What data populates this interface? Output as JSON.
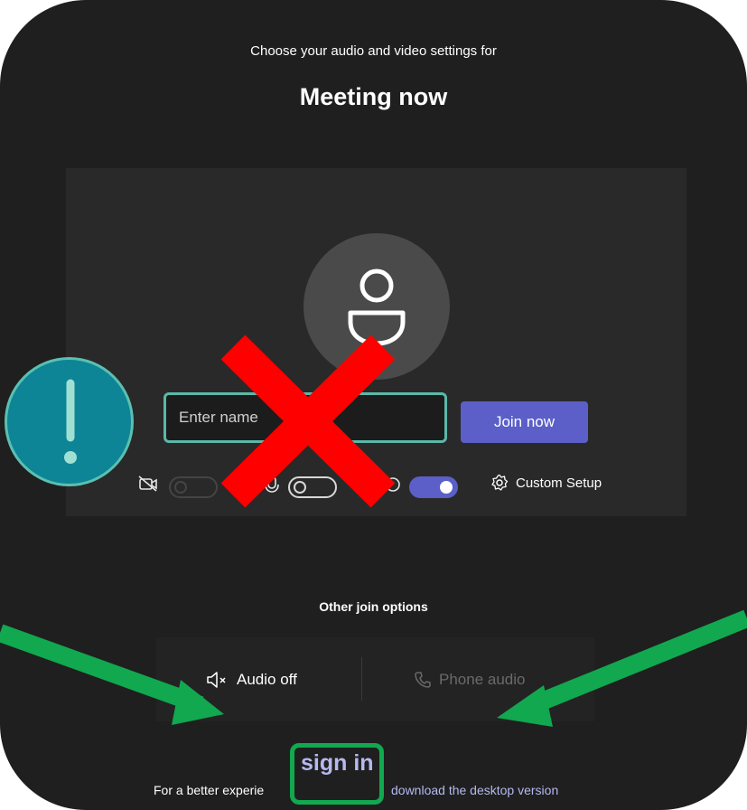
{
  "header": {
    "subtitle": "Choose your audio and video settings for",
    "meeting_title": "Meeting now"
  },
  "prejoin": {
    "name_placeholder": "Enter name",
    "join_label": "Join now",
    "custom_setup_label": "Custom Setup",
    "camera_toggle": "off",
    "mic_toggle": "off",
    "effects_toggle": "on"
  },
  "other_options": {
    "title": "Other join options",
    "audio_off_label": "Audio off",
    "phone_audio_label": "Phone audio"
  },
  "footer": {
    "prefix_text": "For a better experie",
    "sign_in_label": "sign in",
    "download_label": "download the desktop version"
  },
  "annotations": {
    "warning_color": "#0e8497",
    "cross_color": "#ff0000",
    "arrow_color": "#11a84f"
  },
  "icons": [
    "person-icon",
    "camera-off-icon",
    "microphone-icon",
    "blur-icon",
    "gear-icon",
    "speaker-muted-icon",
    "phone-icon",
    "exclamation-icon"
  ]
}
